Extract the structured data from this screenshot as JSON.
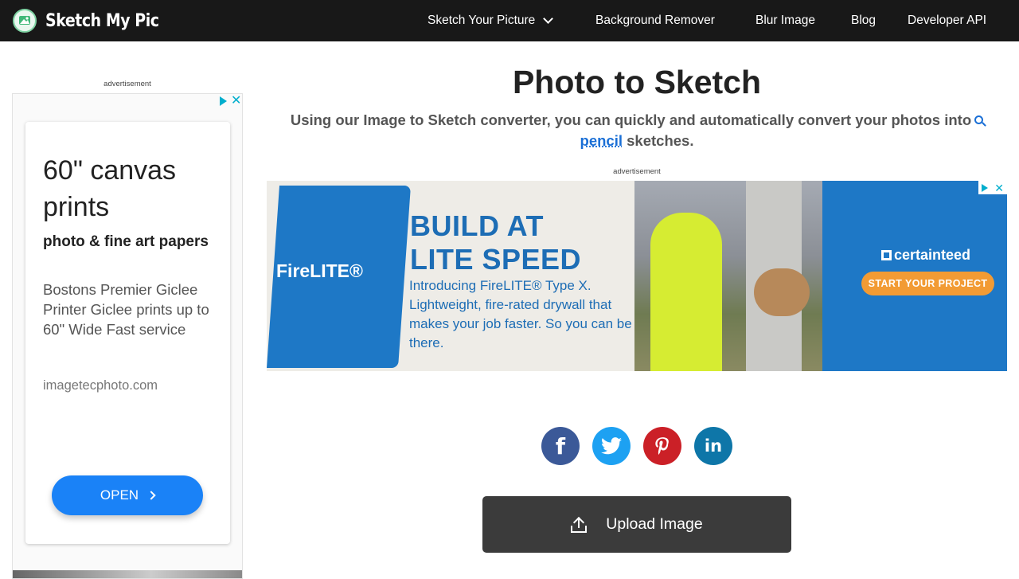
{
  "header": {
    "brand": "Sketch My Pic",
    "nav": [
      {
        "label": "Sketch Your Picture",
        "has_dropdown": true
      },
      {
        "label": "Background Remover"
      },
      {
        "label": "Blur Image"
      },
      {
        "label": "Blog"
      },
      {
        "label": "Developer API"
      }
    ]
  },
  "left_ad": {
    "label": "advertisement",
    "headline": "60\" canvas prints",
    "subhead": "photo & fine art papers",
    "description": "Bostons Premier Giclee Printer Giclee prints up to 60\" Wide Fast service",
    "url": "imagetecphoto.com",
    "cta": "OPEN"
  },
  "main": {
    "title": "Photo to Sketch",
    "description_before": "Using our Image to Sketch converter, you can quickly and automatically convert your photos into",
    "description_link": "pencil",
    "description_after": " sketches.",
    "ad_label": "advertisement"
  },
  "banner_ad": {
    "brand": "FireLITE®",
    "headline_line1": "BUILD AT",
    "headline_line2": "LITE SPEED",
    "body": "Introducing FireLITE® Type X. Lightweight, fire-rated drywall that makes your job faster. So you can be there.",
    "advertiser": "certainteed",
    "cta": "START YOUR PROJECT"
  },
  "social": [
    {
      "network": "facebook",
      "glyph": "f",
      "color": "#3b5998"
    },
    {
      "network": "twitter",
      "glyph": "🐦",
      "color": "#1da1f2"
    },
    {
      "network": "pinterest",
      "glyph": "P",
      "color": "#cb2027"
    },
    {
      "network": "linkedin",
      "glyph": "in",
      "color": "#0e76a8"
    }
  ],
  "upload": {
    "label": "Upload Image"
  }
}
